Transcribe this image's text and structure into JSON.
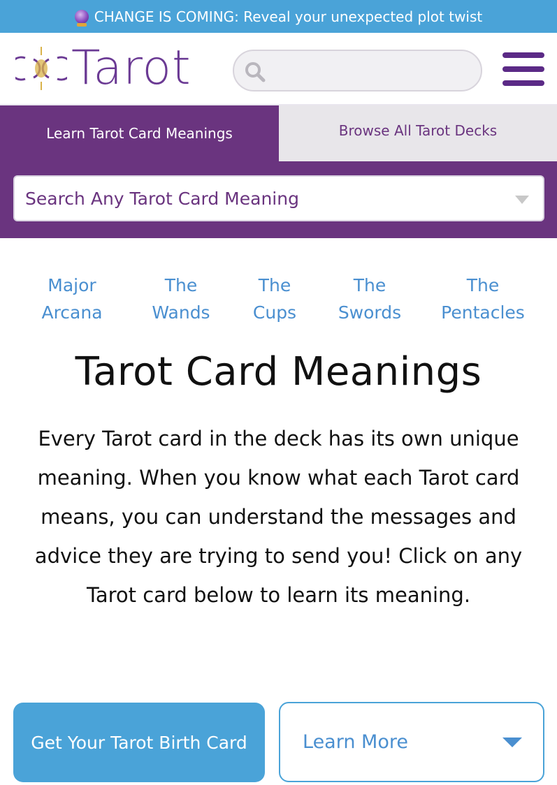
{
  "promo": {
    "icon": "crystal-ball-icon",
    "text": "CHANGE IS COMING: Reveal your unexpected plot twist"
  },
  "header": {
    "logo_text": "Tarot",
    "logo_icon": "moon-phases-icon",
    "search_placeholder": "",
    "search_icon": "search-icon",
    "menu_icon": "hamburger-menu-icon"
  },
  "tabs": {
    "active_label": "Learn Tarot Card Meanings",
    "inactive_label": "Browse All Tarot Decks",
    "select_placeholder": "Search Any Tarot Card Meaning"
  },
  "suits": [
    {
      "line1": "Major",
      "line2": "Arcana"
    },
    {
      "line1": "The",
      "line2": "Wands"
    },
    {
      "line1": "The",
      "line2": "Cups"
    },
    {
      "line1": "The",
      "line2": "Swords"
    },
    {
      "line1": "The",
      "line2": "Pentacles"
    }
  ],
  "main": {
    "title": "Tarot Card Meanings",
    "intro": "Every Tarot card in the deck has its own unique meaning. When you know what each Tarot card means, you can understand the messages and advice they are trying to send you! Click on any Tarot card below to learn its meaning."
  },
  "actions": {
    "birth_card_label": "Get Your Tarot Birth Card",
    "learn_more_label": "Learn More"
  },
  "colors": {
    "brand_purple": "#6a347f",
    "accent_blue": "#4aa3d8",
    "link_blue": "#4a8fd0"
  }
}
